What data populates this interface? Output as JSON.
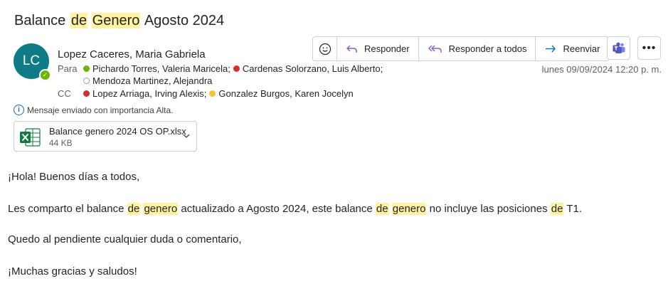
{
  "subject": {
    "part1": "Balance ",
    "hl1": "de",
    "hl2": "Genero",
    "part2": " Agosto 2024"
  },
  "sender": {
    "initials": "LC",
    "name": "Lopez Caceres, Maria Gabriela",
    "presence": "available"
  },
  "to": {
    "label": "Para",
    "recipients": [
      {
        "name": "Pichardo Torres, Valeria Maricela;",
        "status": "available"
      },
      {
        "name": "Cardenas Solorzano, Luis Alberto;",
        "status": "busy"
      },
      {
        "name": "Mendoza Martinez, Alejandra",
        "status": "offline"
      }
    ]
  },
  "cc": {
    "label": "CC",
    "recipients": [
      {
        "name": "Lopez Arriaga, Irving Alexis;",
        "status": "busy"
      },
      {
        "name": "Gonzalez Burgos, Karen Jocelyn",
        "status": "away"
      }
    ]
  },
  "date": "lunes 09/09/2024 12:20 p. m.",
  "toolbar": {
    "reply": "Responder",
    "reply_all": "Responder a todos",
    "forward": "Reenviar"
  },
  "importance": "Mensaje enviado con importancia Alta.",
  "attachment": {
    "name": "Balance genero 2024 OS OP.xlsx",
    "size": "44 KB"
  },
  "body": {
    "greeting": "¡Hola! Buenos días a todos,",
    "line2": {
      "a": "Les comparto el balance ",
      "h1": "de",
      "b": " ",
      "h2": "genero",
      "c": " actualizado a Agosto 2024, este balance ",
      "h3": "de",
      "d": " ",
      "h4": "genero",
      "e": " no incluye las posiciones ",
      "h5": "de",
      "f": " T1."
    },
    "line3": "Quedo al pendiente cualquier duda o comentario,",
    "line4": "¡Muchas gracias y saludos!"
  },
  "colors": {
    "highlight": "#fff3a0",
    "avatar": "#0e7c86",
    "available": "#6bb700",
    "busy": "#d92c2c",
    "away": "#f8c32b",
    "accent_purple": "#8a5cd1",
    "accent_blue": "#0f6cbd",
    "excel_green": "#107c41"
  }
}
